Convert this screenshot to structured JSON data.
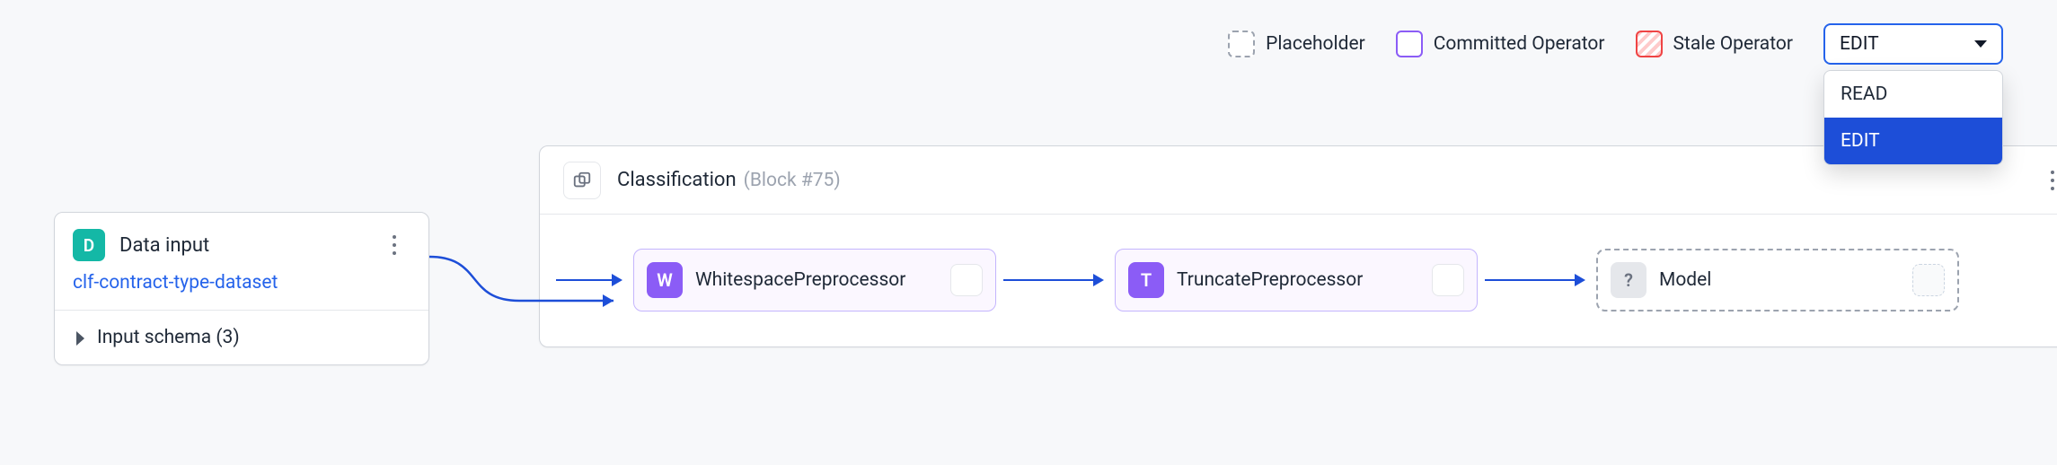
{
  "legend": {
    "placeholder_label": "Placeholder",
    "committed_label": "Committed Operator",
    "stale_label": "Stale Operator"
  },
  "mode_dropdown": {
    "selected": "EDIT",
    "options": [
      "READ",
      "EDIT"
    ]
  },
  "data_input": {
    "icon_letter": "D",
    "title": "Data input",
    "dataset": "clf-contract-type-dataset",
    "schema_row": "Input schema (3)"
  },
  "block": {
    "title": "Classification",
    "subtitle": "(Block #75)"
  },
  "nodes": {
    "whitespace": {
      "icon": "W",
      "label": "WhitespacePreprocessor"
    },
    "truncate": {
      "icon": "T",
      "label": "TruncatePreprocessor"
    },
    "model": {
      "icon": "?",
      "label": "Model"
    }
  }
}
